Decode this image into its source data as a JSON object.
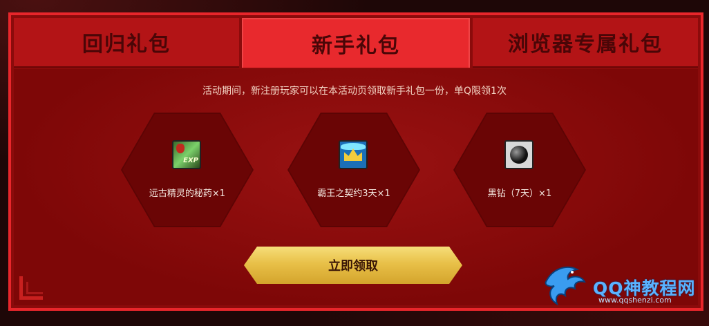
{
  "tabs": [
    {
      "label": "回归礼包",
      "active": false
    },
    {
      "label": "新手礼包",
      "active": true
    },
    {
      "label": "浏览器专属礼包",
      "active": false
    }
  ],
  "notice": "活动期间，新注册玩家可以在本活动页领取新手礼包一份，单Q限领1次",
  "items": [
    {
      "label": "远古精灵的秘药×1",
      "icon": "exp-potion-icon"
    },
    {
      "label": "霸王之契约3天×1",
      "icon": "overlord-pact-icon"
    },
    {
      "label": "黑钻（7天）×1",
      "icon": "black-diamond-icon"
    }
  ],
  "claim_button": "立即领取",
  "watermark": {
    "title": "QQ神教程网",
    "url": "www.qqshenzi.com"
  },
  "colors": {
    "panel": "#8b0b0b",
    "border": "#e8262b",
    "tab_active": "#e8292d",
    "button_gold": "#e8c048"
  }
}
